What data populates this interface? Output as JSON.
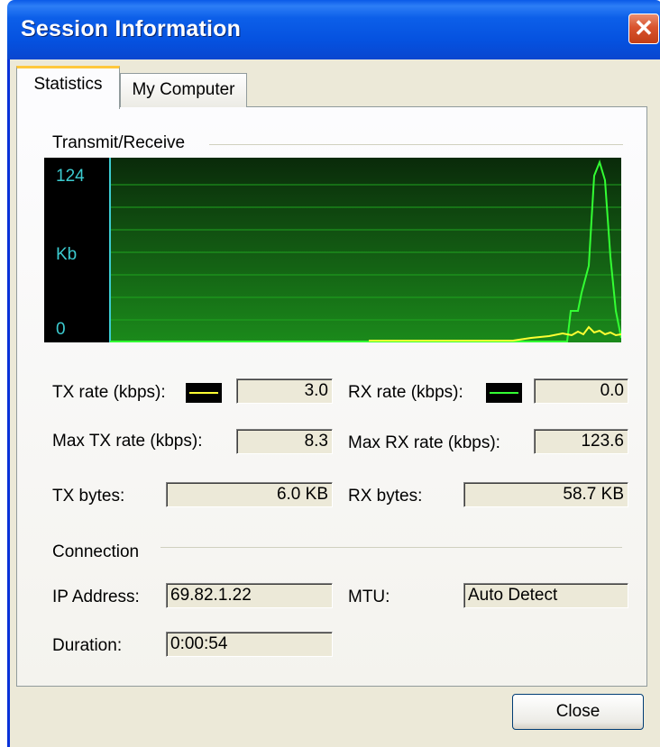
{
  "window": {
    "title": "Session Information",
    "close_glyph": "✕"
  },
  "tabs": [
    {
      "label": "Statistics",
      "active": true
    },
    {
      "label": "My Computer",
      "active": false
    }
  ],
  "transmit_receive": {
    "group_label": "Transmit/Receive",
    "graph": {
      "axis_max_label": "124",
      "unit_label": "Kb",
      "axis_min_label": "0",
      "colors": {
        "background": "#000000",
        "axis": "#3ccbd0",
        "tx_line": "#ffff33",
        "rx_line": "#33ff33",
        "grid": "#1fa51f"
      }
    },
    "tx_rate_label": "TX rate (kbps):",
    "tx_rate_value": "3.0",
    "rx_rate_label": "RX rate (kbps):",
    "rx_rate_value": "0.0",
    "max_tx_label": "Max TX rate (kbps):",
    "max_tx_value": "8.3",
    "max_rx_label": "Max RX rate (kbps):",
    "max_rx_value": "123.6",
    "tx_bytes_label": "TX bytes:",
    "tx_bytes_value": "6.0 KB",
    "rx_bytes_label": "RX bytes:",
    "rx_bytes_value": "58.7 KB"
  },
  "connection": {
    "group_label": "Connection",
    "ip_label": "IP Address:",
    "ip_value": "69.82.1.22",
    "mtu_label": "MTU:",
    "mtu_value": "Auto Detect",
    "duration_label": "Duration:",
    "duration_value": "0:00:54"
  },
  "buttons": {
    "close_label": "Close"
  }
}
